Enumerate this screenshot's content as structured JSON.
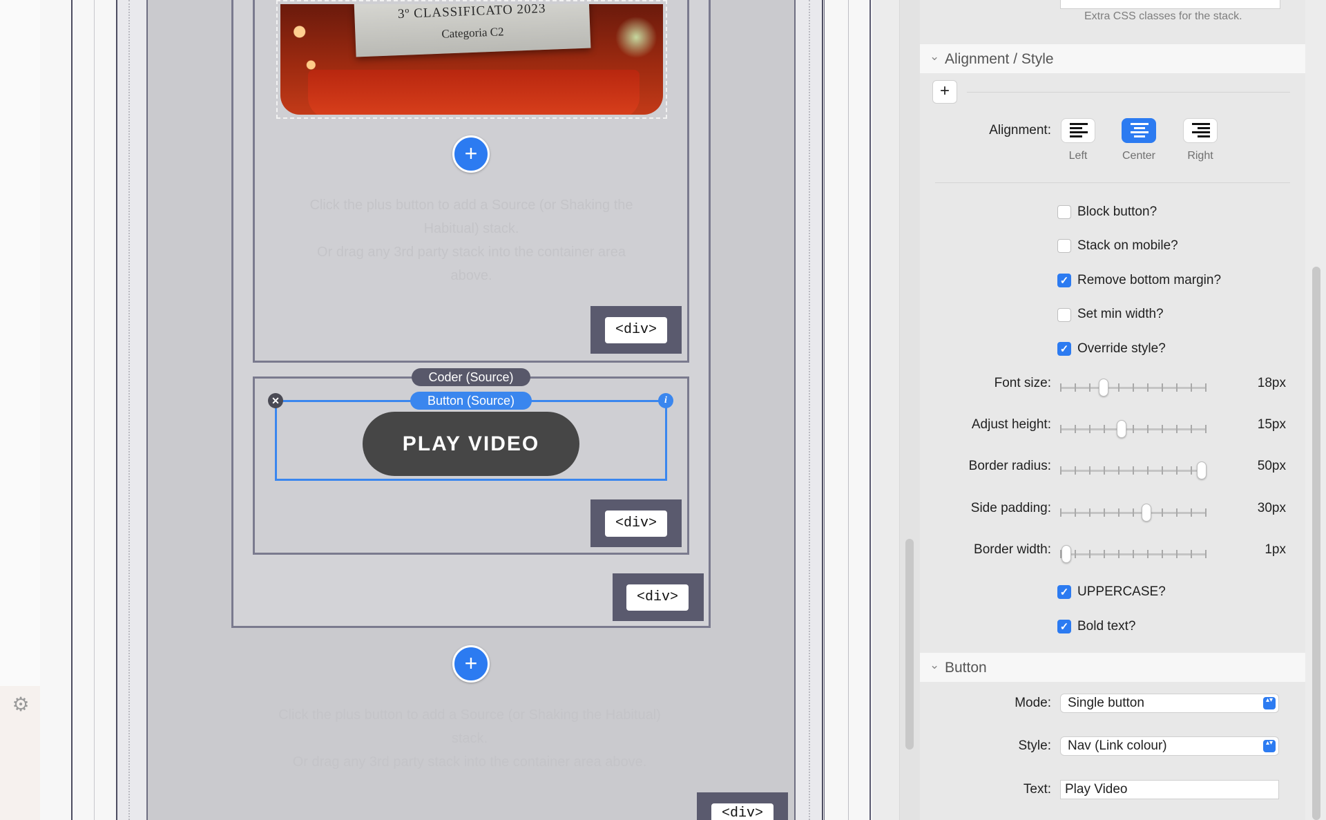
{
  "canvas": {
    "photo": {
      "line1": "3º CLASSIFICATO 2023",
      "line2": "Categoria C2"
    },
    "hint1": [
      "Click the plus button to add a Source (or Shaking the",
      "Habitual) stack.",
      "Or drag any 3rd party stack into the container area",
      "above."
    ],
    "hint2": [
      "Click the plus button to add a Source (or Shaking the Habitual)",
      "stack.",
      "Or drag any 3rd party stack into the container area above."
    ],
    "div_tag": "<div>",
    "coder_label": "Coder (Source)",
    "button_label": "Button (Source)",
    "play_button": "PLAY VIDEO",
    "plus": "+",
    "close_glyph": "✕",
    "info_glyph": "i"
  },
  "inspector": {
    "extra_css_hint": "Extra CSS classes for the stack.",
    "alignment_section": "Alignment / Style",
    "add": "+",
    "alignment_label": "Alignment:",
    "alignment_options": {
      "left": "Left",
      "center": "Center",
      "right": "Right"
    },
    "alignment_selected": "center",
    "checkboxes": {
      "block_button": {
        "label": "Block button?",
        "checked": false
      },
      "stack_mobile": {
        "label": "Stack on mobile?",
        "checked": false
      },
      "remove_margin": {
        "label": "Remove bottom margin?",
        "checked": true
      },
      "min_width": {
        "label": "Set min width?",
        "checked": false
      },
      "override_style": {
        "label": "Override style?",
        "checked": true
      },
      "uppercase": {
        "label": "UPPERCASE?",
        "checked": true
      },
      "bold": {
        "label": "Bold text?",
        "checked": true
      }
    },
    "sliders": {
      "font_size": {
        "label": "Font size:",
        "value": "18px"
      },
      "adjust_height": {
        "label": "Adjust height:",
        "value": "15px"
      },
      "border_radius": {
        "label": "Border radius:",
        "value": "50px"
      },
      "side_padding": {
        "label": "Side padding:",
        "value": "30px"
      },
      "border_width": {
        "label": "Border width:",
        "value": "1px"
      }
    },
    "button_section": "Button",
    "mode": {
      "label": "Mode:",
      "value": "Single button"
    },
    "style": {
      "label": "Style:",
      "value": "Nav (Link colour)"
    },
    "text": {
      "label": "Text:",
      "value": "Play Video"
    },
    "check_glyph": "✓",
    "chevron": "⌄",
    "select_arrows": "▴▾",
    "gear": "⚙"
  }
}
